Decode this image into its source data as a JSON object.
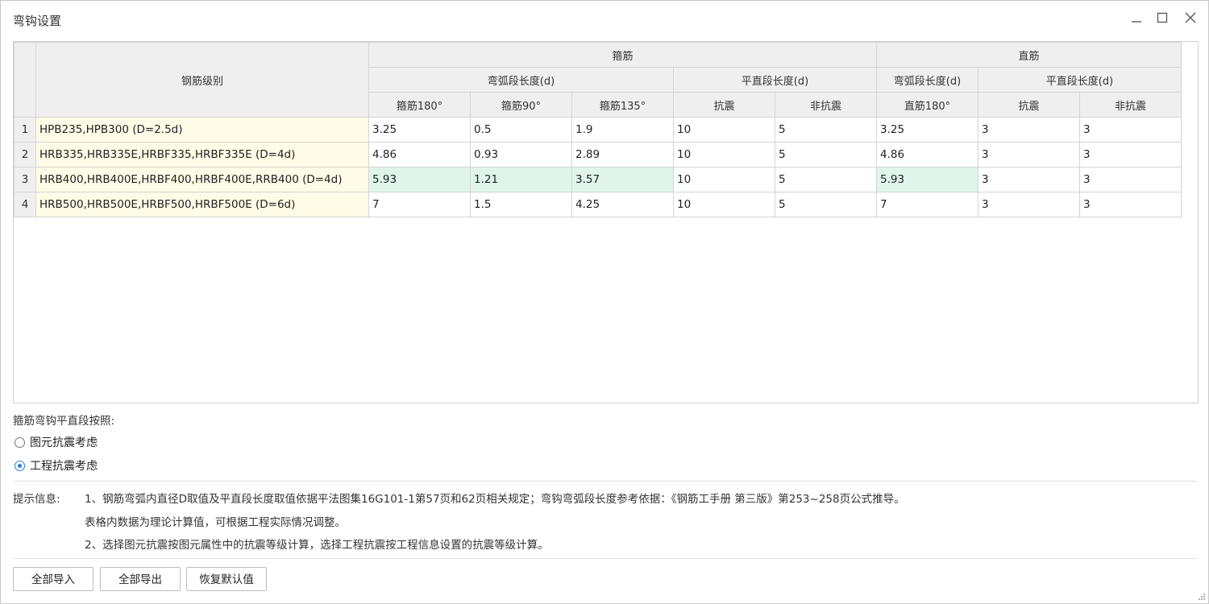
{
  "window": {
    "title": "弯钩设置",
    "minimize_icon": "minimize-icon",
    "maximize_icon": "maximize-icon",
    "close_icon": "close-icon"
  },
  "grid": {
    "header": {
      "grade": "钢筋级别",
      "stirrup": "箍筋",
      "straight": "直筋",
      "arc_len": "弯弧段长度(d)",
      "flat_len": "平直段长度(d)",
      "straight_arc_len": "弯弧段长度(d)",
      "straight_flat_len": "平直段长度(d)",
      "stirrup180": "箍筋180°",
      "stirrup90": "箍筋90°",
      "stirrup135": "箍筋135°",
      "seismic": "抗震",
      "nonseismic": "非抗震",
      "straight180": "直筋180°",
      "straight_seismic": "抗震",
      "straight_nonseismic": "非抗震"
    },
    "rows": [
      {
        "num": "1",
        "grade": "HPB235,HPB300 (D=2.5d)",
        "s180": "3.25",
        "s90": "0.5",
        "s135": "1.9",
        "seis": "10",
        "nonseis": "5",
        "z180": "3.25",
        "zseis": "3",
        "znonseis": "3"
      },
      {
        "num": "2",
        "grade": "HRB335,HRB335E,HRBF335,HRBF335E (D=4d)",
        "s180": "4.86",
        "s90": "0.93",
        "s135": "2.89",
        "seis": "10",
        "nonseis": "5",
        "z180": "4.86",
        "zseis": "3",
        "znonseis": "3"
      },
      {
        "num": "3",
        "grade": "HRB400,HRB400E,HRBF400,HRBF400E,RRB400 (D=4d)",
        "s180": "5.93",
        "s90": "1.21",
        "s135": "3.57",
        "seis": "10",
        "nonseis": "5",
        "z180": "5.93",
        "zseis": "3",
        "znonseis": "3"
      },
      {
        "num": "4",
        "grade": "HRB500,HRB500E,HRBF500,HRBF500E (D=6d)",
        "s180": "7",
        "s90": "1.5",
        "s135": "4.25",
        "seis": "10",
        "nonseis": "5",
        "z180": "7",
        "zseis": "3",
        "znonseis": "3"
      }
    ]
  },
  "options": {
    "label": "箍筋弯钩平直段按照:",
    "radio1": "图元抗震考虑",
    "radio2": "工程抗震考虑",
    "selected": "工程抗震考虑"
  },
  "tips": {
    "label": "提示信息:",
    "line1": "1、钢筋弯弧内直径D取值及平直段长度取值依据平法图集16G101-1第57页和62页相关规定；弯钩弯弧段长度参考依据：《钢筋工手册  第三版》第253~258页公式推导。",
    "line2": "表格内数据为理论计算值，可根据工程实际情况调整。",
    "line3": "2、选择图元抗震按图元属性中的抗震等级计算，选择工程抗震按工程信息设置的抗震等级计算。"
  },
  "buttons": {
    "import_all": "全部导入",
    "export_all": "全部导出",
    "restore": "恢复默认值"
  },
  "colors": {
    "grade_bg": "#fffbe6",
    "highlight_bg": "#dff5ea",
    "radio_accent": "#2f7bd6"
  }
}
